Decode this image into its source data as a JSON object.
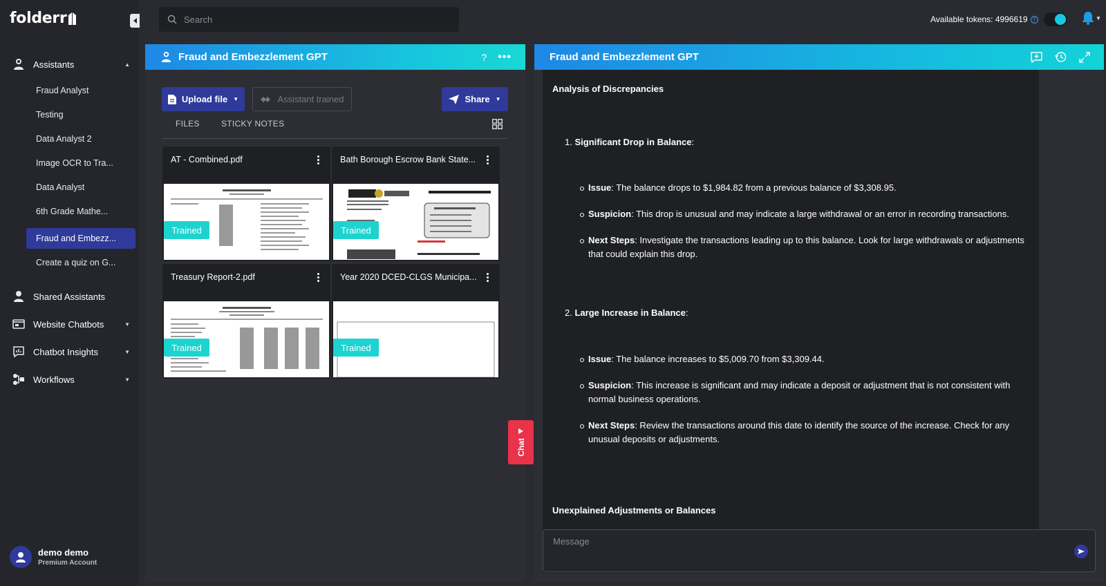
{
  "sidebar": {
    "logo": "folderr",
    "assistants_label": "Assistants",
    "assistants": [
      {
        "label": "Fraud Analyst"
      },
      {
        "label": "Testing"
      },
      {
        "label": "Data Analyst 2"
      },
      {
        "label": "Image OCR to Tra..."
      },
      {
        "label": "Data Analyst"
      },
      {
        "label": "6th Grade Mathe..."
      },
      {
        "label": "Fraud and Embezz..."
      },
      {
        "label": "Create a quiz on G..."
      }
    ],
    "shared_label": "Shared Assistants",
    "website_chatbots_label": "Website Chatbots",
    "chatbot_insights_label": "Chatbot Insights",
    "workflows_label": "Workflows",
    "user": {
      "name": "demo demo",
      "plan": "Premium Account"
    }
  },
  "topbar": {
    "search_placeholder": "Search",
    "tokens_text": "Available tokens: 4996619"
  },
  "left_panel": {
    "title": "Fraud and Embezzlement GPT",
    "help": "?",
    "upload_label": "Upload file",
    "trained_label": "Assistant trained",
    "share_label": "Share",
    "tabs": [
      "FILES",
      "STICKY NOTES"
    ],
    "files": [
      {
        "name": "AT - Combined.pdf",
        "status": "Trained"
      },
      {
        "name": "Bath Borough Escrow Bank State...",
        "status": "Trained"
      },
      {
        "name": "Treasury Report-2.pdf",
        "status": "Trained"
      },
      {
        "name": "Year 2020 DCED-CLGS Municipa...",
        "status": "Trained"
      }
    ],
    "chat_tab": "Chat"
  },
  "right_panel": {
    "title": "Fraud and Embezzlement GPT",
    "heading1": "Analysis of Discrepancies",
    "item1": {
      "num": "1.",
      "title": "Significant Drop in Balance",
      "colon": ":"
    },
    "item1_bullets": [
      {
        "label": "Issue",
        "text": ": The balance drops to $1,984.82 from a previous balance of $3,308.95."
      },
      {
        "label": "Suspicion",
        "text": ": This drop is unusual and may indicate a large withdrawal or an error in recording transactions."
      },
      {
        "label": "Next Steps",
        "text": ": Investigate the transactions leading up to this balance. Look for large withdrawals or adjustments that could explain this drop."
      }
    ],
    "item2": {
      "num": "2.",
      "title": "Large Increase in Balance",
      "colon": ":"
    },
    "item2_bullets": [
      {
        "label": "Issue",
        "text": ": The balance increases to $5,009.70 from $3,309.44."
      },
      {
        "label": "Suspicion",
        "text": ": This increase is significant and may indicate a deposit or adjustment that is not consistent with normal business operations."
      },
      {
        "label": "Next Steps",
        "text": ": Review the transactions around this date to identify the source of the increase. Check for any unusual deposits or adjustments."
      }
    ],
    "heading2": "Unexplained Adjustments or Balances",
    "message_placeholder": "Message"
  },
  "colors": {
    "accent": "#2f3a9a",
    "header_gradient_start": "#1f88e5",
    "header_gradient_end": "#18d8d4",
    "trained_badge": "#1dd3d0",
    "chat_tab": "#e8334a"
  }
}
